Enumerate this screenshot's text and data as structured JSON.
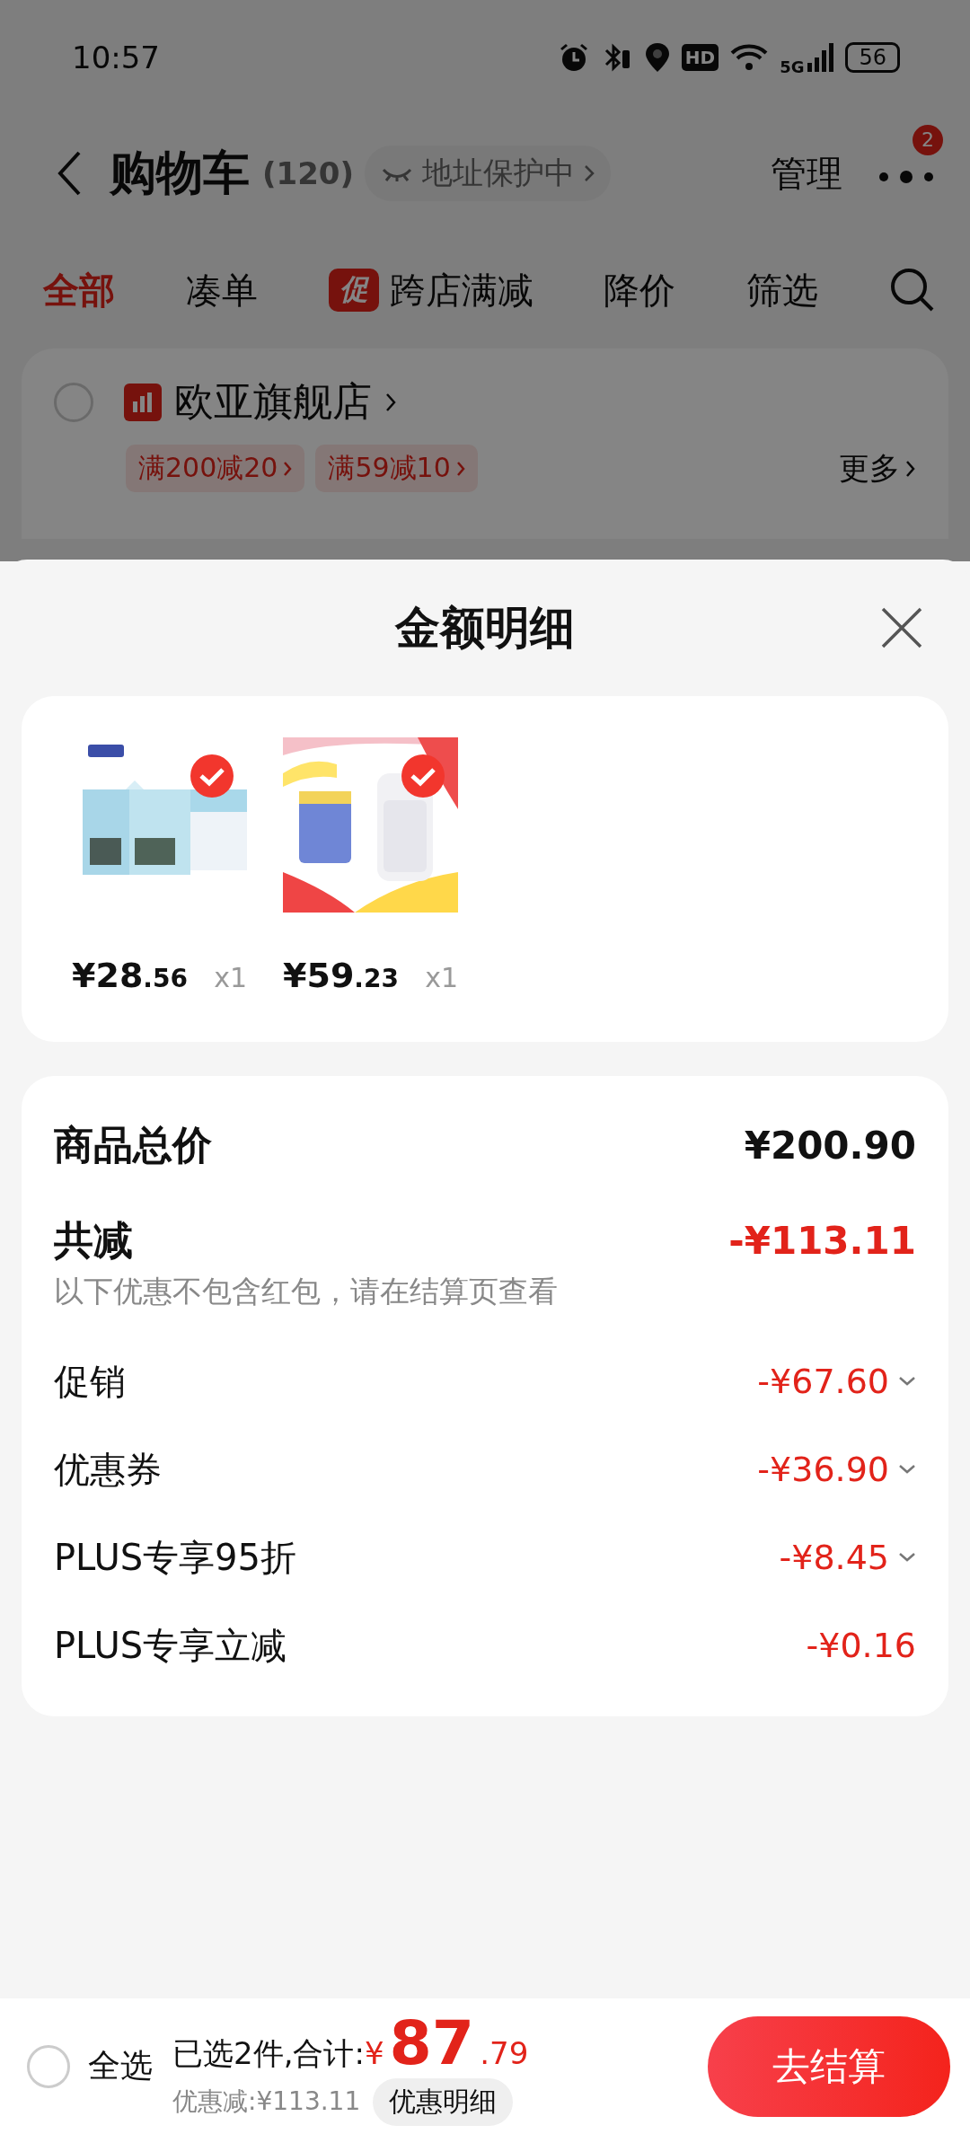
{
  "status_bar": {
    "time": "10:57",
    "hd": "HD",
    "network": "5G",
    "battery": "56"
  },
  "header": {
    "title": "购物车",
    "count": "(120)",
    "address_pill": "地址保护中",
    "manage": "管理",
    "more_badge": "2"
  },
  "tabs": [
    {
      "label": "全部",
      "selected": true
    },
    {
      "label": "凑单",
      "selected": false
    },
    {
      "label": "跨店满减",
      "badge": "促",
      "selected": false
    },
    {
      "label": "降价",
      "selected": false
    },
    {
      "label": "筛选",
      "selected": false
    }
  ],
  "store": {
    "name": "欧亚旗舰店",
    "checked": false,
    "coupons": [
      "满200减20",
      "满59减10"
    ],
    "more": "更多"
  },
  "sheet": {
    "title": "金额明细",
    "items": [
      {
        "kind": "milk",
        "price": "¥28",
        "price_decimal": ".56",
        "quantity": "x1",
        "selected": true
      },
      {
        "kind": "bottle",
        "price": "¥59",
        "price_decimal": ".23",
        "quantity": "x1",
        "selected": true
      }
    ],
    "rows": [
      {
        "kind": "total",
        "label": "商品总价",
        "amount": "¥200.90"
      },
      {
        "kind": "reduction",
        "label": "共减",
        "amount": "-¥113.11",
        "note": "以下优惠不包含红包，请在结算页查看"
      },
      {
        "kind": "line",
        "label": "促销",
        "amount": "-¥67.60",
        "expandable": true
      },
      {
        "kind": "line",
        "label": "优惠券",
        "amount": "-¥36.90",
        "expandable": true
      },
      {
        "kind": "line",
        "label": "PLUS专享95折",
        "amount": "-¥8.45",
        "expandable": true
      },
      {
        "kind": "line",
        "label": "PLUS专享立减",
        "amount": "-¥0.16",
        "expandable": false
      }
    ]
  },
  "bottom_bar": {
    "select_all": "全选",
    "checked": false,
    "summary": "已选2件,合计:",
    "currency": "¥",
    "total": "87",
    "total_decimal": ".79",
    "discount": "优惠减:¥113.11",
    "details_button": "优惠明细",
    "checkout": "去结算"
  }
}
